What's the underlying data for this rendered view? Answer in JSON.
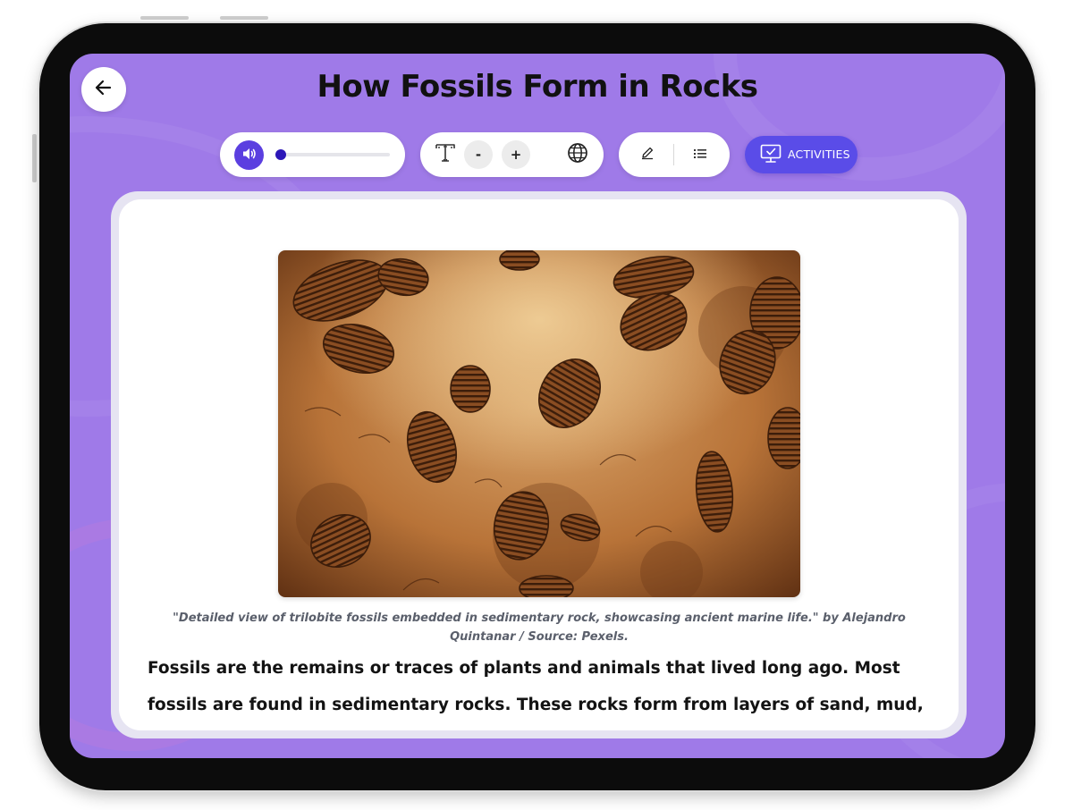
{
  "page": {
    "title": "How Fossils Form in Rocks"
  },
  "toolbar": {
    "back": {
      "icon": "arrow-left-icon"
    },
    "audio": {
      "icon": "speaker-icon",
      "progress": 0.0
    },
    "text_tools": {
      "font_icon": "text-size-icon",
      "decrease_label": "-",
      "increase_label": "+",
      "language_icon": "globe-icon"
    },
    "annotate": {
      "highlight_icon": "pencil-icon",
      "outline_icon": "list-icon"
    },
    "activities": {
      "label": "ACTIVITIES",
      "icon": "monitor-check-icon"
    }
  },
  "article": {
    "image": {
      "subject": "trilobite fossils in sedimentary rock"
    },
    "caption": "\"Detailed view of trilobite fossils embedded in sedimentary rock, showcasing ancient marine life.\" by Alejandro Quintanar / Source: Pexels.",
    "body": "Fossils are the remains or traces of plants and animals that lived long ago. Most fossils are found in sedimentary rocks. These rocks form from layers of sand, mud,"
  },
  "colors": {
    "background": "#9f7ae8",
    "accent": "#5a4ce8",
    "audio_button": "#5b3fe0",
    "title": "#111111"
  }
}
